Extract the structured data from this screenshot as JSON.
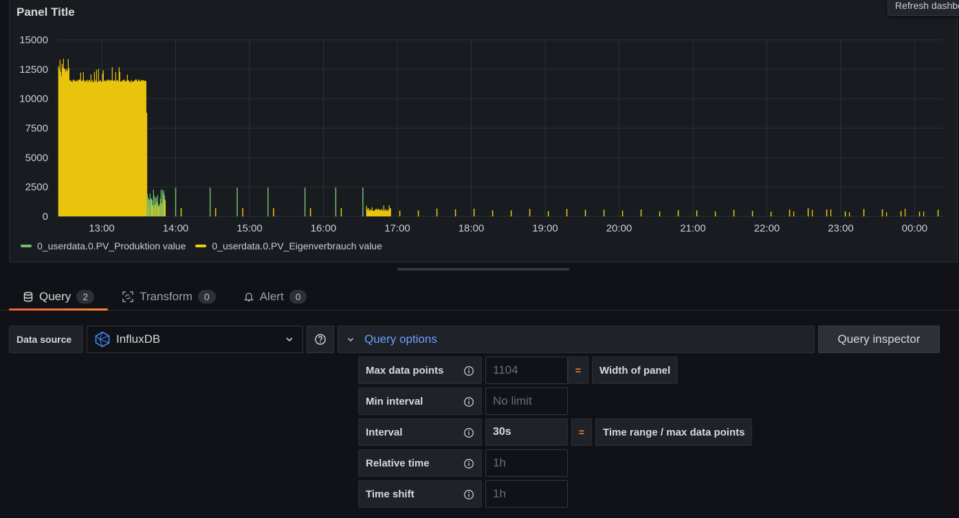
{
  "panel": {
    "title": "Panel Title",
    "tooltip": "Refresh dashboard"
  },
  "chart_data": {
    "type": "bar",
    "y_ticks": [
      "15000",
      "12500",
      "10000",
      "7500",
      "5000",
      "2500",
      "0"
    ],
    "x_ticks": [
      "13:00",
      "14:00",
      "15:00",
      "16:00",
      "17:00",
      "18:00",
      "19:00",
      "20:00",
      "21:00",
      "22:00",
      "23:00",
      "00:00"
    ],
    "ylim": [
      0,
      15000
    ],
    "grid": true,
    "legend_position": "bottom-left",
    "series": [
      {
        "name": "0_userdata.0.PV_Produktion value",
        "color": "#73bf69"
      },
      {
        "name": "0_userdata.0.PV_Eigenverbrauch value",
        "color": "#f2cc0c"
      }
    ],
    "approx_segments": [
      {
        "series": 1,
        "from": "12:25",
        "to": "13:36",
        "value": 11500,
        "peak": 13500
      },
      {
        "series": 0,
        "from": "13:37",
        "to": "13:52",
        "value": 1500,
        "peak": 2400
      },
      {
        "series": 1,
        "from": "16:35",
        "to": "16:55",
        "value": 600,
        "peak": 1000
      }
    ]
  },
  "tabs": [
    {
      "label": "Query",
      "count": "2",
      "icon": "database-icon"
    },
    {
      "label": "Transform",
      "count": "0",
      "icon": "transform-icon"
    },
    {
      "label": "Alert",
      "count": "0",
      "icon": "bell-icon"
    }
  ],
  "datasource": {
    "label": "Data source",
    "value": "InfluxDB"
  },
  "query_options": {
    "title": "Query options",
    "inspector_label": "Query inspector",
    "rows": [
      {
        "label": "Max data points",
        "placeholder": "1104",
        "note": "Width of panel"
      },
      {
        "label": "Min interval",
        "placeholder": "No limit"
      },
      {
        "label": "Interval",
        "value": "30s",
        "note": "Time range / max data points"
      },
      {
        "label": "Relative time",
        "placeholder": "1h"
      },
      {
        "label": "Time shift",
        "placeholder": "1h"
      }
    ]
  }
}
